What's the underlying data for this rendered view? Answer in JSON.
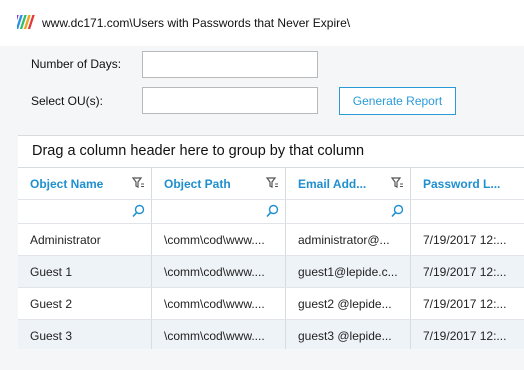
{
  "window": {
    "title": "www.dc171.com\\Users with Passwords that Never Expire\\"
  },
  "form": {
    "days_label": "Number of Days:",
    "days_value": "",
    "ou_label": "Select OU(s):",
    "ou_value": "",
    "generate_label": "Generate Report"
  },
  "grid": {
    "group_hint": "Drag a column header here to group by that column",
    "columns": [
      "Object Name",
      "Object Path",
      "Email Add...",
      "Password L..."
    ],
    "rows": [
      [
        "Administrator",
        "\\comm\\cod\\www....",
        "administrator@...",
        "7/19/2017 12:..."
      ],
      [
        "Guest 1",
        "\\comm\\cod\\www....",
        "guest1@lepide.c...",
        "7/19/2017 12:..."
      ],
      [
        "Guest 2",
        "\\comm\\cod\\www....",
        "guest2 @lepide...",
        "7/19/2017 12:..."
      ],
      [
        "Guest 3",
        "\\comm\\cod\\www....",
        "guest3 @lepide...",
        "7/19/2017 12:..."
      ]
    ]
  },
  "colors": {
    "accent": "#1f8fd0",
    "button_border": "#2b9bd8",
    "row_alt": "#eef3f8",
    "logo": [
      "#8b3fd0",
      "#2d8fe0",
      "#2dbf6a",
      "#f0a020",
      "#e03a3a"
    ]
  },
  "icons": {
    "logo": "lepide-logo",
    "filter": "funnel-filter-icon",
    "search": "magnifier-search-icon"
  }
}
